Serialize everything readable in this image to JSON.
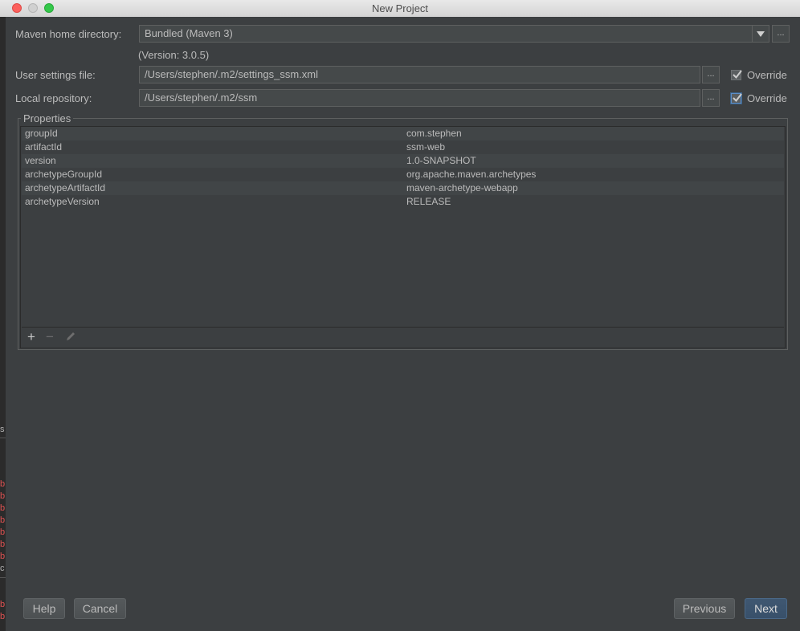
{
  "window": {
    "title": "New Project"
  },
  "maven": {
    "home_label": "Maven home directory:",
    "home_value": "Bundled (Maven 3)",
    "version_text": "(Version: 3.0.5)",
    "settings_label": "User settings file:",
    "settings_value": "/Users/stephen/.m2/settings_ssm.xml",
    "settings_override": "Override",
    "settings_override_checked": true,
    "repo_label": "Local repository:",
    "repo_value": "/Users/stephen/.m2/ssm",
    "repo_override": "Override",
    "repo_override_checked": true,
    "browse_label": "..."
  },
  "properties": {
    "title": "Properties",
    "rows": [
      {
        "key": "groupId",
        "value": "com.stephen"
      },
      {
        "key": "artifactId",
        "value": "ssm-web"
      },
      {
        "key": "version",
        "value": "1.0-SNAPSHOT"
      },
      {
        "key": "archetypeGroupId",
        "value": "org.apache.maven.archetypes"
      },
      {
        "key": "archetypeArtifactId",
        "value": "maven-archetype-webapp"
      },
      {
        "key": "archetypeVersion",
        "value": "RELEASE"
      }
    ],
    "toolbar": {
      "add_icon": "plus-icon",
      "remove_icon": "minus-icon",
      "edit_icon": "pencil-icon"
    }
  },
  "buttons": {
    "help": "Help",
    "cancel": "Cancel",
    "previous": "Previous",
    "next": "Next"
  },
  "colors": {
    "accent_button": "#3f5771",
    "background": "#3c3f41"
  },
  "background_strip": {
    "chars": [
      "s",
      "b",
      "b",
      "b",
      "b",
      "b",
      "b",
      "b",
      "c",
      "b",
      "b"
    ]
  }
}
